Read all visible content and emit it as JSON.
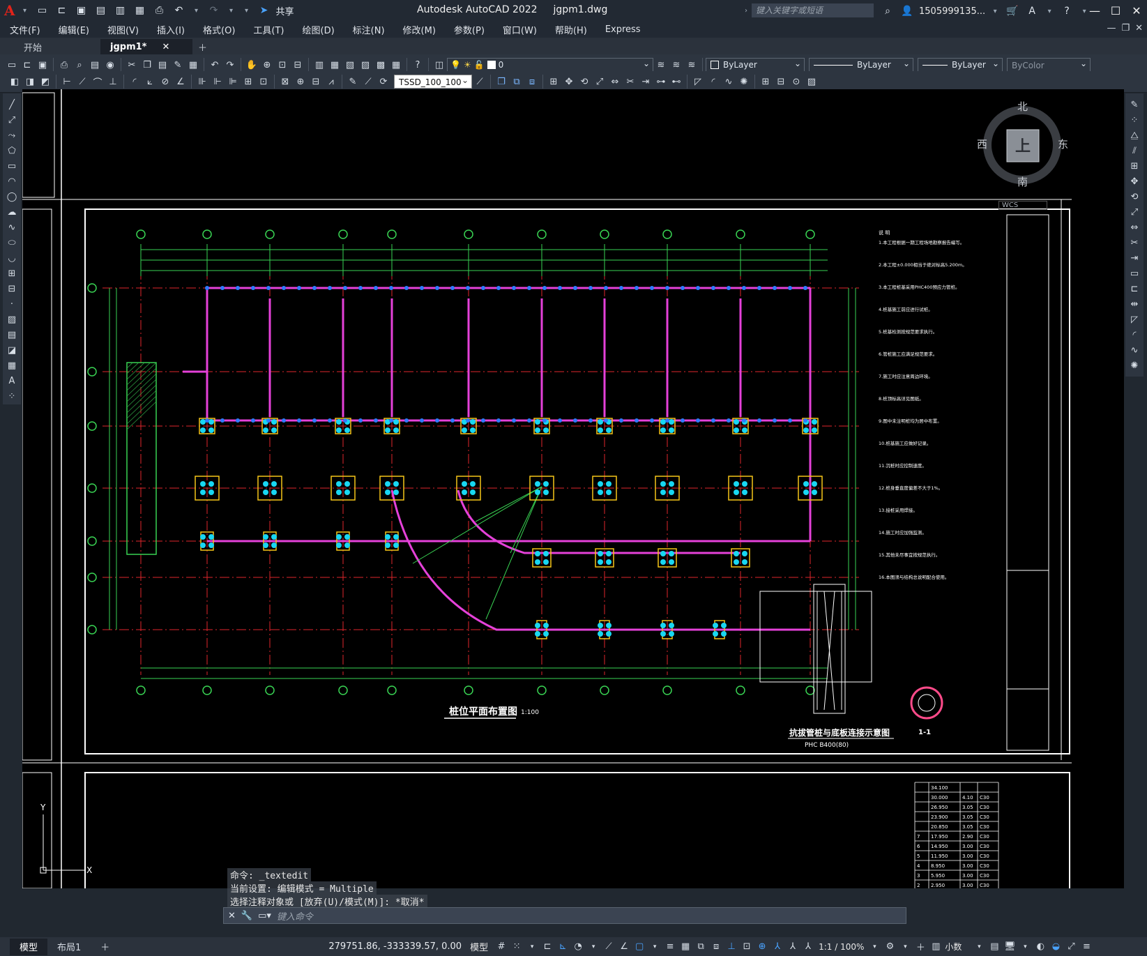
{
  "app": {
    "title": "Autodesk AutoCAD 2022",
    "file": "jgpm1.dwg",
    "share_label": "共享",
    "search_placeholder": "键入关键字或短语",
    "user": "1505999135..."
  },
  "menu": [
    "文件(F)",
    "编辑(E)",
    "视图(V)",
    "插入(I)",
    "格式(O)",
    "工具(T)",
    "绘图(D)",
    "标注(N)",
    "修改(M)",
    "参数(P)",
    "窗口(W)",
    "帮助(H)",
    "Express"
  ],
  "tabs": [
    {
      "label": "开始",
      "active": false
    },
    {
      "label": "jgpm1*",
      "active": true
    }
  ],
  "toolbar": {
    "layer_value": "0",
    "color_value": "ByLayer",
    "linetype_value": "ByLayer",
    "lineweight_value": "ByLayer",
    "plotstyle_value": "ByColor",
    "dimstyle_value": "TSSD_100_100"
  },
  "navcube": {
    "n": "北",
    "s": "南",
    "e": "东",
    "w": "西",
    "top": "上",
    "wcs": "WCS"
  },
  "drawing": {
    "main_title": "桩位平面布置图",
    "main_scale": "1:100",
    "detail_title": "抗拔管桩与底板连接示意图",
    "detail_subtitle": "PHC B400(80)",
    "section_label": "1-1",
    "notes_title": "说 明",
    "notes": [
      "1.本工程根据一期工程场地勘察报告编写。",
      "2.本工程±0.000相当于绝对标高5.200m。",
      "3.本工程桩基采用PHC400预应力管桩。",
      "4.桩基施工前应进行试桩。",
      "5.桩基检测按规范要求执行。",
      "6.管桩施工应满足规范要求。",
      "7.施工时应注意周边环境。",
      "8.桩顶标高详见图纸。",
      "9.图中未注明桩均为居中布置。",
      "10.桩基施工应做好记录。",
      "11.沉桩时应控制速度。",
      "12.桩身垂直度偏差不大于1%。",
      "13.接桩采用焊接。",
      "14.施工时应加强监测。",
      "15.其他未尽事宜按规范执行。",
      "16.本图须与结构总说明配合使用。"
    ],
    "table_rows": [
      [
        "",
        "34.100",
        "",
        ""
      ],
      [
        "",
        "30.000",
        "4.10",
        "C30"
      ],
      [
        "",
        "26.950",
        "3.05",
        "C30"
      ],
      [
        "",
        "23.900",
        "3.05",
        "C30"
      ],
      [
        "",
        "20.850",
        "3.05",
        "C30"
      ],
      [
        "7",
        "17.950",
        "2.90",
        "C30"
      ],
      [
        "6",
        "14.950",
        "3.00",
        "C30"
      ],
      [
        "5",
        "11.950",
        "3.00",
        "C30"
      ],
      [
        "4",
        "8.950",
        "3.00",
        "C30"
      ],
      [
        "3",
        "5.950",
        "3.00",
        "C30"
      ],
      [
        "2",
        "2.950",
        "3.00",
        "C30"
      ]
    ]
  },
  "command": {
    "history": [
      "命令: _textedit",
      "当前设置: 编辑模式 = Multiple",
      "选择注释对象或 [放弃(U)/模式(M)]: *取消*"
    ],
    "placeholder": "键入命令"
  },
  "status": {
    "layout_tabs": [
      {
        "label": "模型",
        "active": true
      },
      {
        "label": "布局1",
        "active": false
      }
    ],
    "coords": "279751.86, -333339.57, 0.00",
    "space": "模型",
    "scale": "1:1 / 100%",
    "units": "小数"
  }
}
